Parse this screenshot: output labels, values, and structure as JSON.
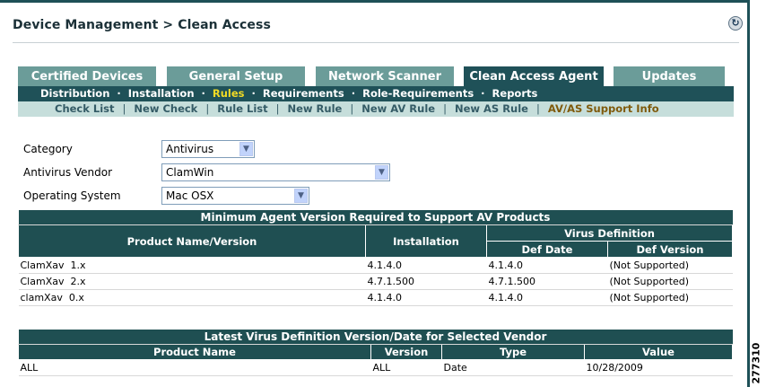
{
  "header": {
    "title": "Device Management > Clean Access"
  },
  "tabs": [
    {
      "label": "Certified Devices"
    },
    {
      "label": "General Setup"
    },
    {
      "label": "Network Scanner"
    },
    {
      "label": "Clean Access Agent"
    },
    {
      "label": "Updates"
    }
  ],
  "subnav": [
    "Distribution",
    "Installation",
    "Rules",
    "Requirements",
    "Role-Requirements",
    "Reports"
  ],
  "subsubnav": [
    "Check List",
    "New Check",
    "Rule List",
    "New Rule",
    "New AV Rule",
    "New AS Rule",
    "AV/AS Support Info"
  ],
  "form": {
    "category_label": "Category",
    "category_value": "Antivirus",
    "vendor_label": "Antivirus Vendor",
    "vendor_value": "ClamWin",
    "os_label": "Operating System",
    "os_value": "Mac OSX"
  },
  "table1": {
    "caption": "Minimum Agent Version Required to Support AV Products",
    "headers": {
      "product": "Product Name/Version",
      "installation": "Installation",
      "virus_def": "Virus Definition",
      "def_date": "Def Date",
      "def_version": "Def Version"
    },
    "rows": [
      {
        "product": "ClamXav  1.x",
        "installation": "4.1.4.0",
        "def_date": "4.1.4.0",
        "def_version": "(Not Supported)"
      },
      {
        "product": "ClamXav  2.x",
        "installation": "4.7.1.500",
        "def_date": "4.7.1.500",
        "def_version": "(Not Supported)"
      },
      {
        "product": "clamXav  0.x",
        "installation": "4.1.4.0",
        "def_date": "4.1.4.0",
        "def_version": "(Not Supported)"
      }
    ]
  },
  "table2": {
    "caption": "Latest Virus Definition Version/Date for Selected Vendor",
    "headers": {
      "product": "Product Name",
      "version": "Version",
      "type": "Type",
      "value": "Value"
    },
    "rows": [
      {
        "product": "ALL",
        "version": "ALL",
        "type": "Date",
        "value": "10/28/2009"
      }
    ]
  },
  "figure_number": "277310"
}
